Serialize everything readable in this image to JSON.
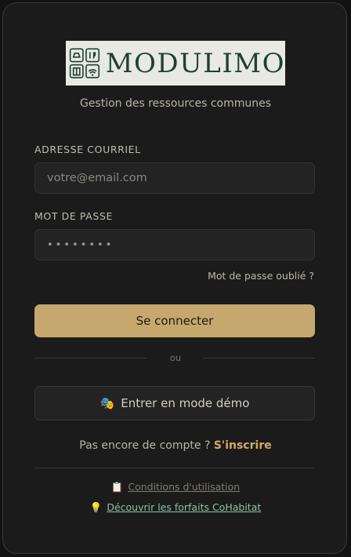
{
  "brand": {
    "name": "Modulimo",
    "wordmark": "MODULIMO",
    "tagline": "Gestion des ressources communes",
    "logo_icon": "building-services-grid-icon",
    "logo_color": "#1f3f36"
  },
  "form": {
    "email_label": "ADRESSE COURRIEL",
    "email_placeholder": "votre@email.com",
    "password_label": "MOT DE PASSE",
    "password_value": "••••••••",
    "forgot_link": "Mot de passe oublié ?",
    "submit_label": "Se connecter"
  },
  "divider": "ou",
  "demo": {
    "icon": "🎭",
    "label": "Entrer en mode démo"
  },
  "signup": {
    "prompt": "Pas encore de compte ?",
    "link": "S'inscrire"
  },
  "footer": {
    "terms_icon": "📋",
    "terms_label": "Conditions d'utilisation",
    "plans_icon": "💡",
    "plans_label": "Découvrir les forfaits CoHabitat"
  },
  "colors": {
    "accent": "#c6a86e",
    "link_accent": "#d4a96a",
    "plans_link": "#8cc2a8",
    "card_bg": "#1b1b1b"
  }
}
